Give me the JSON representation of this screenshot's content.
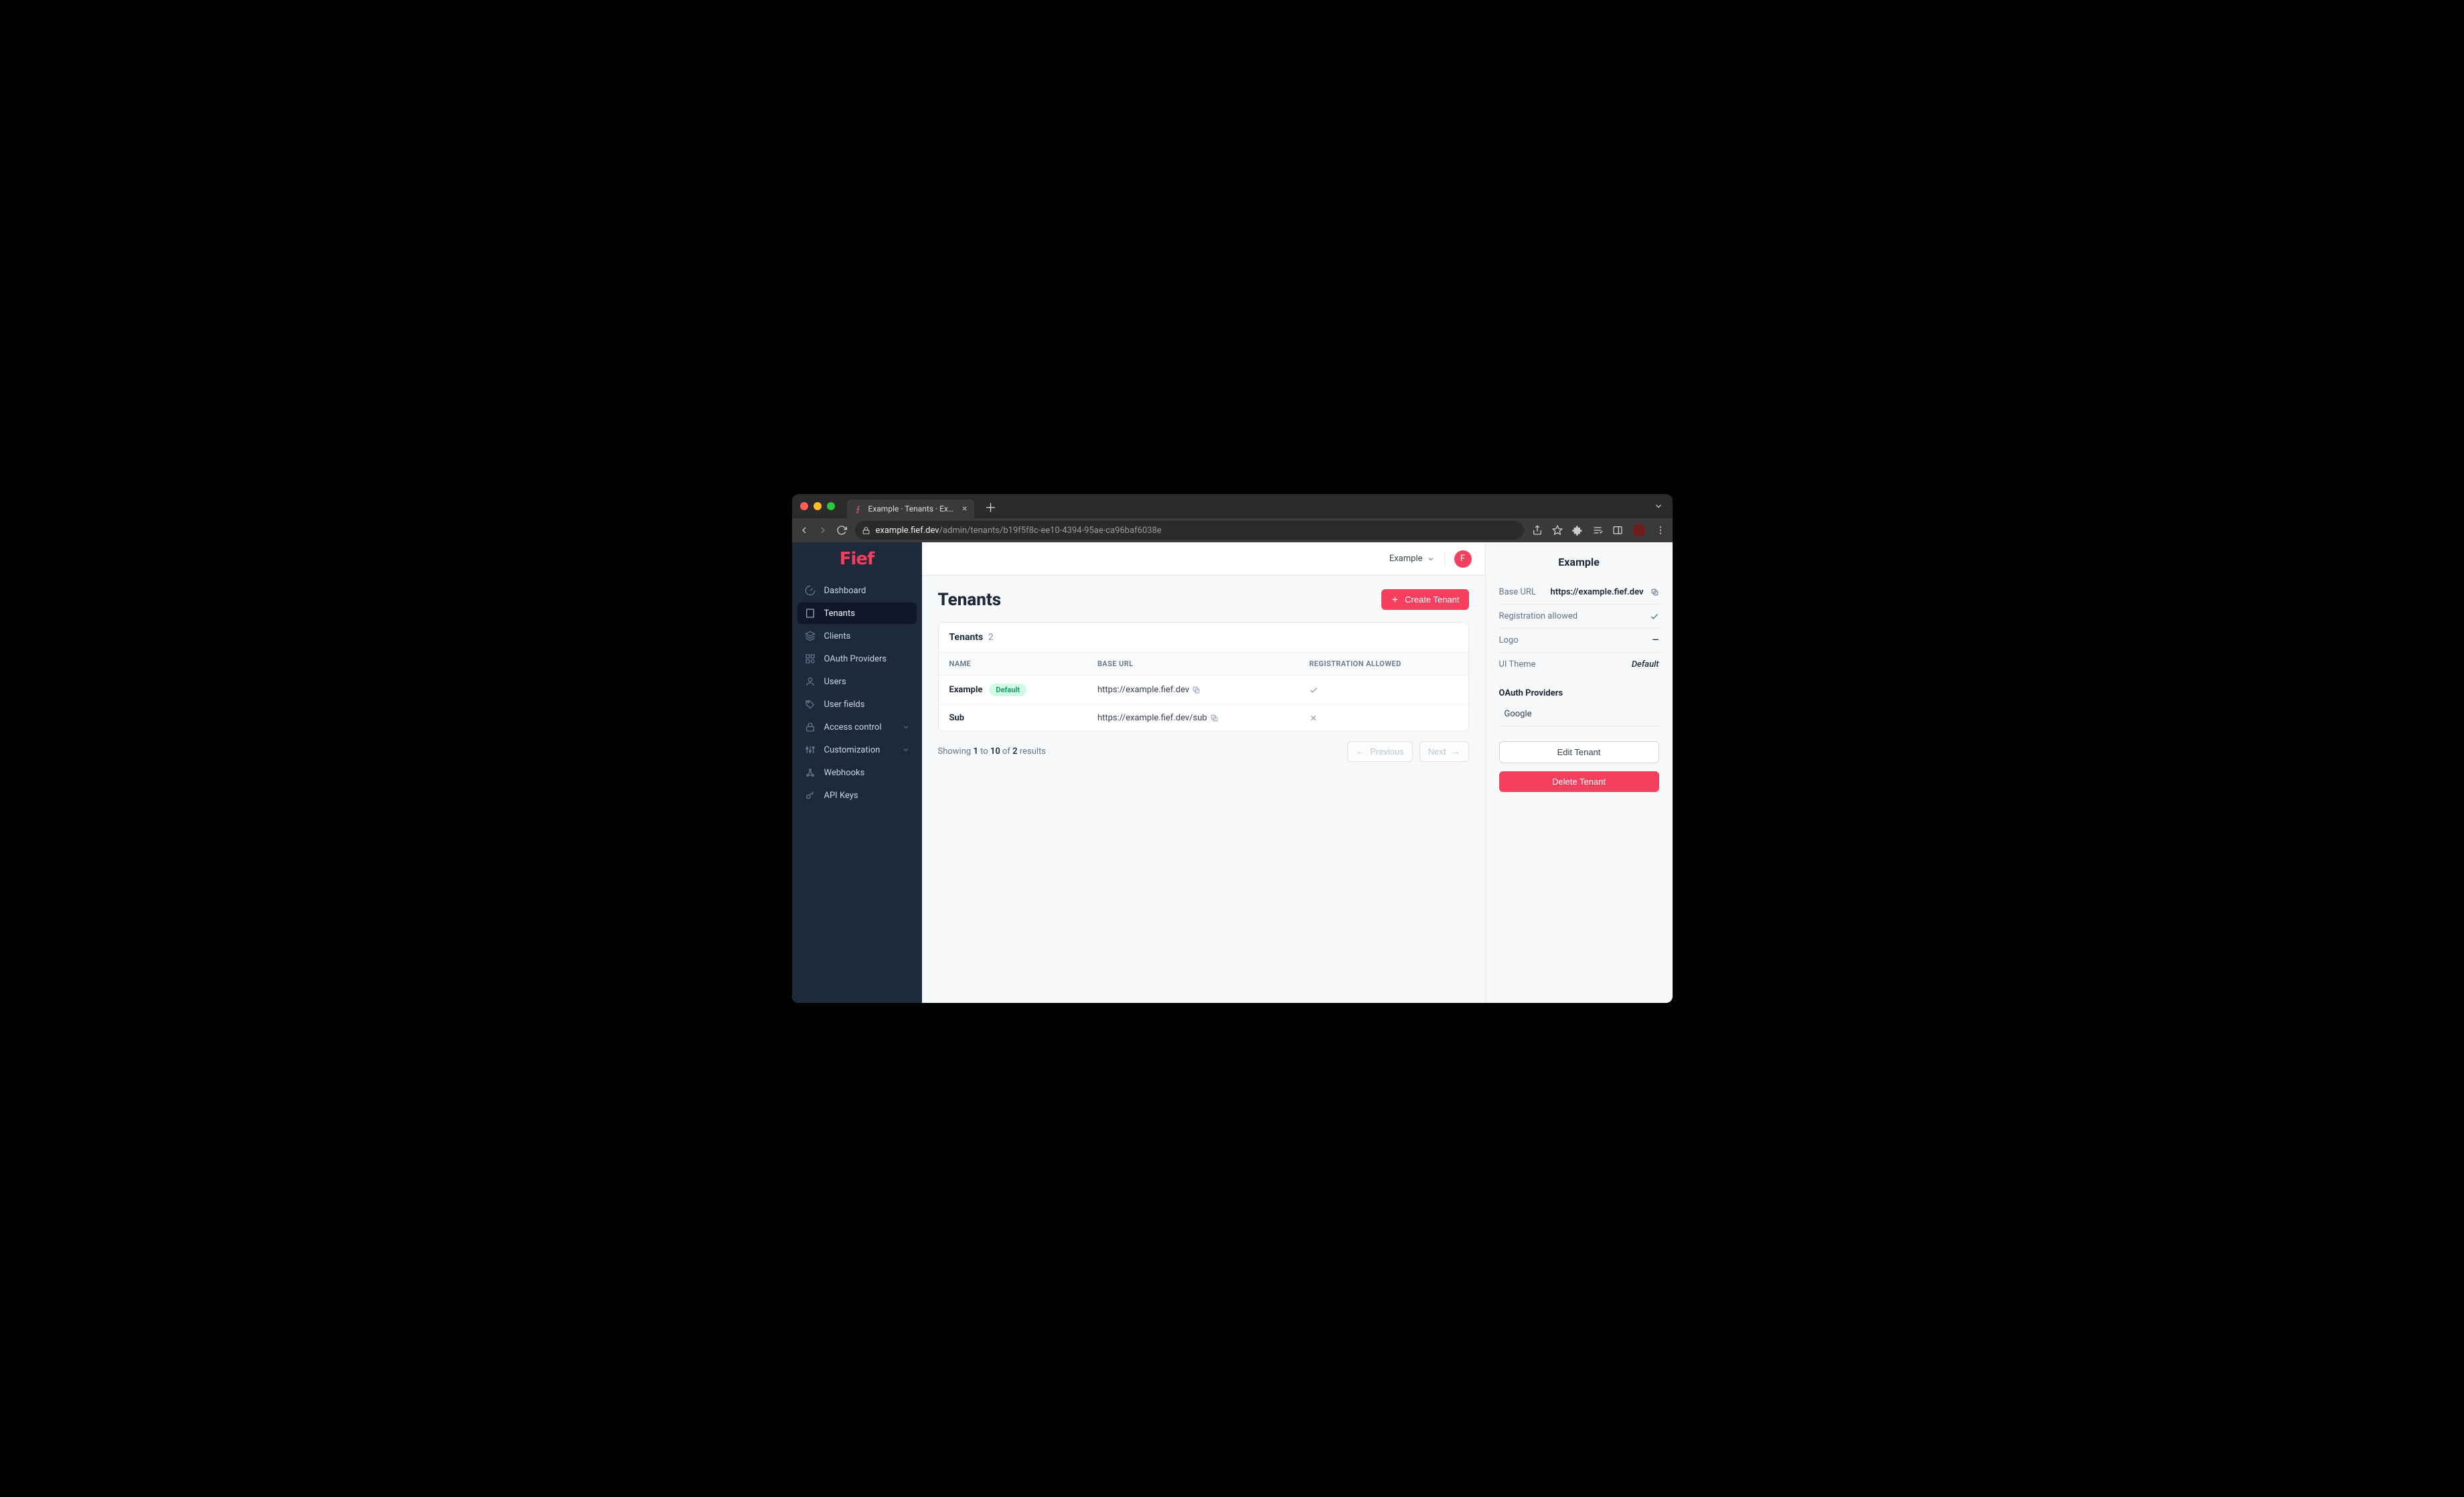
{
  "browser": {
    "tab_title": "Example · Tenants · Example · F",
    "url_host": "example.fief.dev",
    "url_path": "/admin/tenants/b19f5f8c-ee10-4394-95ae-ca96baf6038e"
  },
  "brand": "Fief",
  "nav": [
    {
      "label": "Dashboard",
      "icon": "gauge"
    },
    {
      "label": "Tenants",
      "icon": "building",
      "active": true
    },
    {
      "label": "Clients",
      "icon": "layers"
    },
    {
      "label": "OAuth Providers",
      "icon": "oauth"
    },
    {
      "label": "Users",
      "icon": "user"
    },
    {
      "label": "User fields",
      "icon": "tag"
    },
    {
      "label": "Access control",
      "icon": "lock",
      "expandable": true
    },
    {
      "label": "Customization",
      "icon": "sliders",
      "expandable": true
    },
    {
      "label": "Webhooks",
      "icon": "webhook"
    },
    {
      "label": "API Keys",
      "icon": "key"
    }
  ],
  "topbar": {
    "workspace": "Example",
    "avatar_initial": "F"
  },
  "page": {
    "title": "Tenants",
    "create_label": "Create Tenant",
    "table_title": "Tenants",
    "table_count": "2",
    "columns": {
      "name": "NAME",
      "base_url": "BASE URL",
      "registration": "REGISTRATION ALLOWED"
    },
    "rows": [
      {
        "name": "Example",
        "default": "Default",
        "base_url": "https://example.fief.dev",
        "registration_allowed": true
      },
      {
        "name": "Sub",
        "base_url": "https://example.fief.dev/sub",
        "registration_allowed": false
      }
    ],
    "pagination": {
      "showing": "Showing",
      "from": "1",
      "to_word": "to",
      "to": "10",
      "of_word": "of",
      "total": "2",
      "results_word": "results",
      "prev": "Previous",
      "next": "Next"
    }
  },
  "detail": {
    "title": "Example",
    "rows": {
      "base_url_label": "Base URL",
      "base_url_value": "https://example.fief.dev",
      "registration_label": "Registration allowed",
      "logo_label": "Logo",
      "logo_value": "—",
      "theme_label": "UI Theme",
      "theme_value": "Default"
    },
    "providers_heading": "OAuth Providers",
    "providers": [
      "Google"
    ],
    "edit_label": "Edit Tenant",
    "delete_label": "Delete Tenant"
  }
}
